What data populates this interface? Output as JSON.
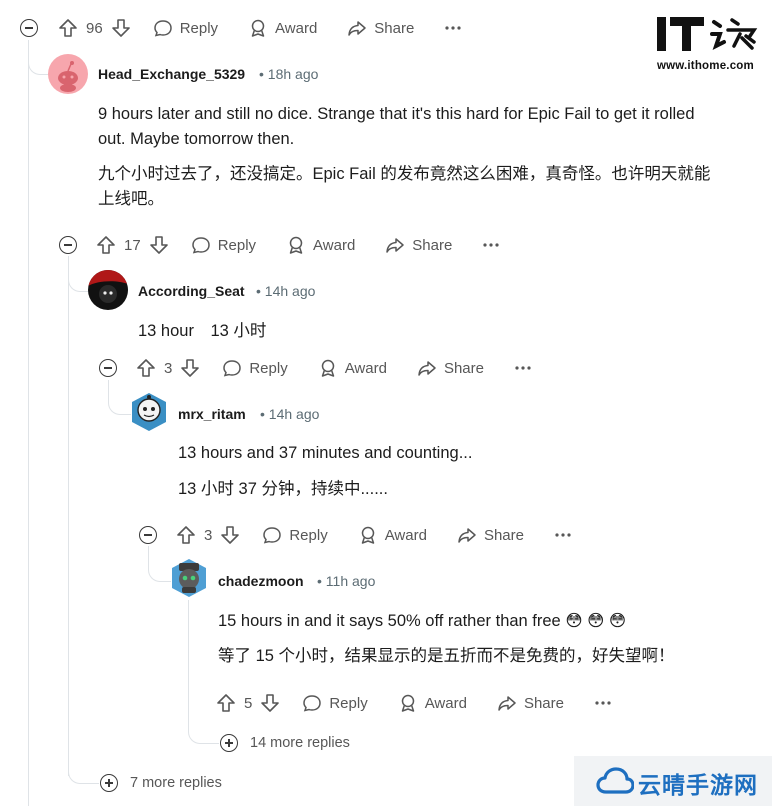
{
  "watermark_top": {
    "logo_text": "IT之家",
    "url": "www.ithome.com"
  },
  "watermark_bottom": {
    "text": "云晴手游网"
  },
  "actions_labels": {
    "reply": "Reply",
    "award": "Award",
    "share": "Share"
  },
  "top_bar": {
    "score": "96"
  },
  "comments": [
    {
      "username": "Head_Exchange_5329",
      "time": "18h ago",
      "lines": [
        "9 hours later and still no dice. Strange that it's this hard for Epic Fail to get it rolled",
        "out. Maybe tomorrow then.",
        "九个小时过去了，还没搞定。Epic Fail 的发布竟然这么困难，真奇怪。也许明天就能",
        "上线吧。"
      ],
      "score": "17"
    },
    {
      "username": "According_Seat",
      "time": "14h ago",
      "lines": [
        "13 hour　13 小时"
      ],
      "score": "3"
    },
    {
      "username": "mrx_ritam",
      "time": "14h ago",
      "lines": [
        "13 hours and 37 minutes and counting...",
        "13 小时 37 分钟，持续中......"
      ],
      "score": "3"
    },
    {
      "username": "chadezmoon",
      "time": "11h ago",
      "lines": [
        "15 hours in and it says 50% off rather than free 😳 😳 😳",
        "等了 15 个小时，结果显示的是五折而不是免费的，好失望啊！"
      ],
      "score": "5"
    }
  ],
  "more_replies": {
    "inner": "14 more replies",
    "outer": "7 more replies"
  }
}
